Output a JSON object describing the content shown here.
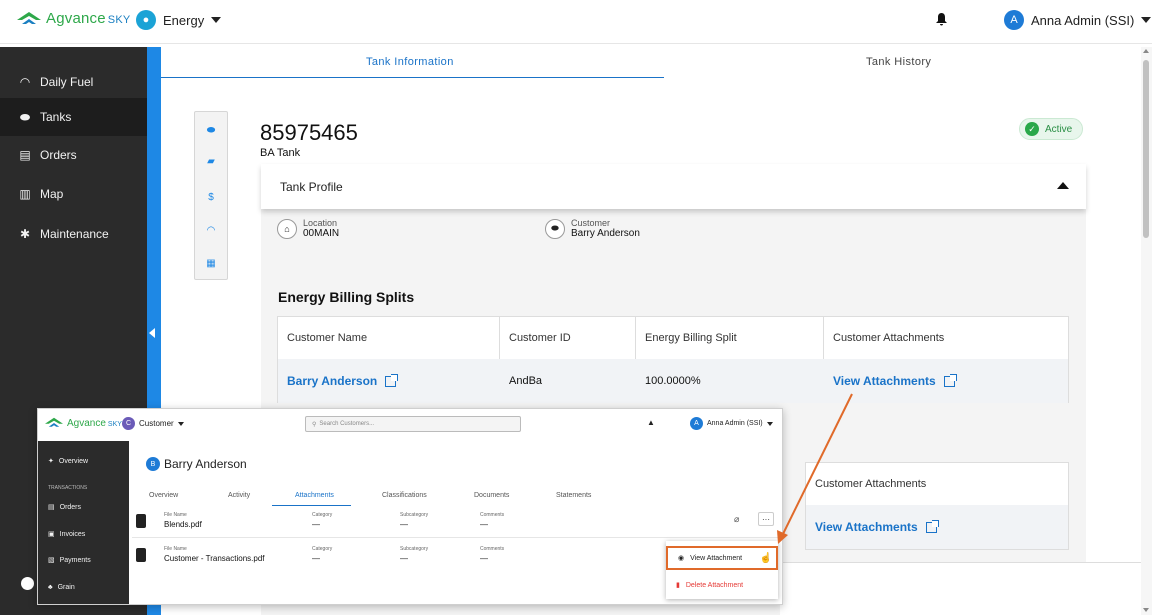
{
  "header": {
    "logo_text": "Agvance",
    "logo_suffix": "SKY",
    "module": "Energy",
    "user": "Anna Admin (SSI)",
    "user_initial": "A"
  },
  "sidebar": {
    "items": [
      {
        "label": "Daily Fuel",
        "icon": "gauge-icon"
      },
      {
        "label": "Tanks",
        "icon": "tank-icon"
      },
      {
        "label": "Orders",
        "icon": "orders-icon"
      },
      {
        "label": "Map",
        "icon": "map-icon"
      },
      {
        "label": "Maintenance",
        "icon": "gear-icon"
      }
    ],
    "active": "Tanks"
  },
  "tabs": {
    "info": "Tank Information",
    "history": "Tank History",
    "selected": "Tank Information"
  },
  "tank": {
    "number": "85975465",
    "name": "BA Tank",
    "status": "Active",
    "profile_title": "Tank Profile",
    "location_label": "Location",
    "location_value": "00MAIN",
    "customer_label": "Customer",
    "customer_value": "Barry Anderson"
  },
  "billing": {
    "title": "Energy Billing Splits",
    "columns": [
      "Customer Name",
      "Customer ID",
      "Energy Billing Split",
      "Customer Attachments"
    ],
    "rows": [
      {
        "name": "Barry Anderson",
        "id": "AndBa",
        "split": "100.0000%",
        "attachments": "View Attachments"
      }
    ]
  },
  "billing2": {
    "column": "Customer Attachments",
    "link": "View Attachments"
  },
  "overlay": {
    "logo_text": "Agvance",
    "logo_suffix": "SKY",
    "module": "Customer",
    "module_initial": "C",
    "search_placeholder": "Search Customers...",
    "user": "Anna Admin (SSI)",
    "user_initial": "A",
    "side": {
      "overview": "Overview",
      "section": "TRANSACTIONS",
      "items": [
        "Orders",
        "Invoices",
        "Payments",
        "Grain"
      ]
    },
    "customer_initial": "B",
    "customer_name": "Barry Anderson",
    "tabs": [
      "Overview",
      "Activity",
      "Attachments",
      "Classifications",
      "Documents",
      "Statements"
    ],
    "active_tab": "Attachments",
    "field_labels": {
      "file": "File Name",
      "category": "Category",
      "subcategory": "Subcategory",
      "comments": "Comments"
    },
    "files": [
      {
        "name": "Blends.pdf",
        "category": "—",
        "subcategory": "—",
        "comments": "—"
      },
      {
        "name": "Customer - Transactions.pdf",
        "category": "—",
        "subcategory": "—",
        "comments": "—"
      }
    ],
    "menu": {
      "view": "View Attachment",
      "delete": "Delete Attachment"
    }
  },
  "colors": {
    "accent": "#1e88e5",
    "sidebar": "#2b2b2b",
    "active_green": "#2aa84a",
    "callout": "#e06a2a",
    "delete_red": "#e53935"
  }
}
